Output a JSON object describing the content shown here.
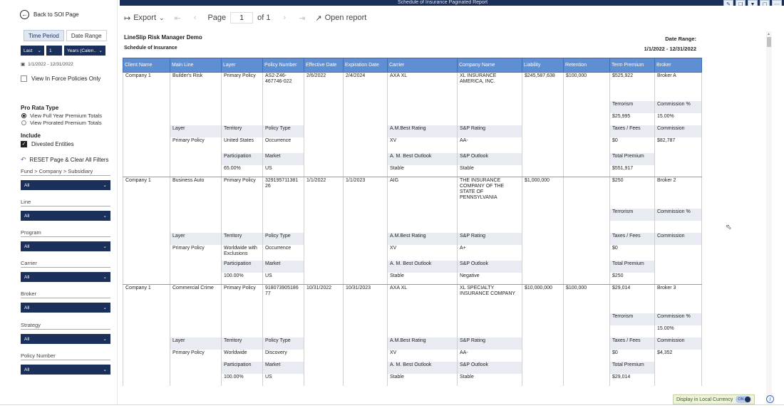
{
  "sidebar": {
    "back_label": "Back to SOI Page",
    "tabs": [
      {
        "label": "Time Period"
      },
      {
        "label": "Date Range"
      }
    ],
    "period": {
      "relative": "Last",
      "count": "1",
      "unit": "Years (Calen.."
    },
    "date_range_text": "1/1/2022 - 12/31/2022",
    "in_force_label": "View In Force Policies Only",
    "pro_rata_title": "Pro Rata Type",
    "pro_rata_options": [
      {
        "label": "View Full Year Premium Totals"
      },
      {
        "label": "View Prorated Premium Totals"
      }
    ],
    "include_title": "Include",
    "divested_label": "Divested Entities",
    "reset_label": "RESET Page & Clear All Filters",
    "filters": [
      {
        "label": "Fund > Company > Subsidiary",
        "value": "All"
      },
      {
        "label": "Line",
        "value": "All"
      },
      {
        "label": "Program",
        "value": "All"
      },
      {
        "label": "Carrier",
        "value": "All"
      },
      {
        "label": "Broker",
        "value": "All"
      },
      {
        "label": "Strategy",
        "value": "All"
      },
      {
        "label": "Policy Number",
        "value": "All"
      }
    ]
  },
  "topbar": {
    "title": "Schedule of Insurance Paginated Report"
  },
  "toolbar": {
    "export_label": "Export",
    "page_label": "Page",
    "page_value": "1",
    "of_label": "of 1",
    "open_report_label": "Open report"
  },
  "report": {
    "title": "LineSlip Risk Manager Demo",
    "subtitle": "Schedule of Insurance",
    "date_range_label": "Date Range:",
    "date_range_value": "1/1/2022 - 12/31/2022",
    "columns": [
      "Client Name",
      "Main Line",
      "Layer",
      "Policy Number",
      "Effective Date",
      "Expiration Date",
      "Carrier",
      "Company Name",
      "Liability",
      "Retention",
      "Term Premium",
      "Broker"
    ],
    "sub_labels": {
      "terrorism": "Terrorism",
      "commission_pct": "Commission %",
      "layer": "Layer",
      "territory": "Territory",
      "policy_type": "Policy Type",
      "am_best_rating": "A.M.Best Rating",
      "sp_rating": "S&P Rating",
      "taxes_fees": "Taxes / Fees",
      "commission": "Commission",
      "participation": "Participation",
      "market": "Market",
      "am_best_outlook": "A. M. Best Outlook",
      "sp_outlook": "S&P Outlook",
      "total_premium": "Total Premium"
    },
    "policies": [
      {
        "client": "Company 1",
        "main_line": "Builder's Risk",
        "layer": "Primary Policy",
        "policy_number": "AS2-Z46-467746-022",
        "effective": "2/6/2022",
        "expiration": "2/4/2024",
        "carrier": "AXA XL",
        "company": "XL INSURANCE AMERICA, INC.",
        "liability": "$245,587,638",
        "retention": "$100,000",
        "term_premium": "$525,922",
        "broker": "Broker A",
        "terrorism": "$25,995",
        "commission_pct": "15.00%",
        "layer2": "Primary Policy",
        "territory": "United States",
        "policy_type": "Occurrence",
        "am_best_rating": "XV",
        "sp_rating": "AA-",
        "taxes_fees": "$0",
        "commission": "$82,787",
        "participation": "65.00%",
        "market": "US",
        "am_best_outlook": "Stable",
        "sp_outlook": "Stable",
        "total_premium": "$551,917"
      },
      {
        "client": "Company 1",
        "main_line": "Business Auto",
        "layer": "Primary Policy",
        "policy_number": "329195711381 26",
        "effective": "1/1/2022",
        "expiration": "1/1/2023",
        "carrier": "AIG",
        "company": "THE INSURANCE COMPANY OF THE STATE OF PENNSYLVANIA",
        "liability": "$1,000,000",
        "retention": "",
        "term_premium": "$250",
        "broker": "Broker 2",
        "terrorism": "",
        "commission_pct": "",
        "layer2": "Primary Policy",
        "territory": "Worldwide with Exclusions",
        "policy_type": "Occurrence",
        "am_best_rating": "XV",
        "sp_rating": "A+",
        "taxes_fees": "$0",
        "commission": "",
        "participation": "100.00%",
        "market": "US",
        "am_best_outlook": "Stable",
        "sp_outlook": "Negative",
        "total_premium": "$250"
      },
      {
        "client": "Company 1",
        "main_line": "Commercial Crime",
        "layer": "Primary Policy",
        "policy_number": "918073905186 77",
        "effective": "10/31/2022",
        "expiration": "10/31/2023",
        "carrier": "AXA XL",
        "company": "XL SPECIALTY INSURANCE COMPANY",
        "liability": "$10,000,000",
        "retention": "$100,000",
        "term_premium": "$29,014",
        "broker": "Broker 3",
        "terrorism": "",
        "commission_pct": "15.00%",
        "layer2": "Primary Policy",
        "territory": "Worldwide",
        "policy_type": "Discovery",
        "am_best_rating": "XV",
        "sp_rating": "AA-",
        "taxes_fees": "$0",
        "commission": "$4,352",
        "participation": "100.00%",
        "market": "US",
        "am_best_outlook": "Stable",
        "sp_outlook": "Stable",
        "total_premium": "$29,014"
      }
    ]
  },
  "footer": {
    "local_currency_label": "Display in Local Currency",
    "toggle_label": "ON"
  }
}
